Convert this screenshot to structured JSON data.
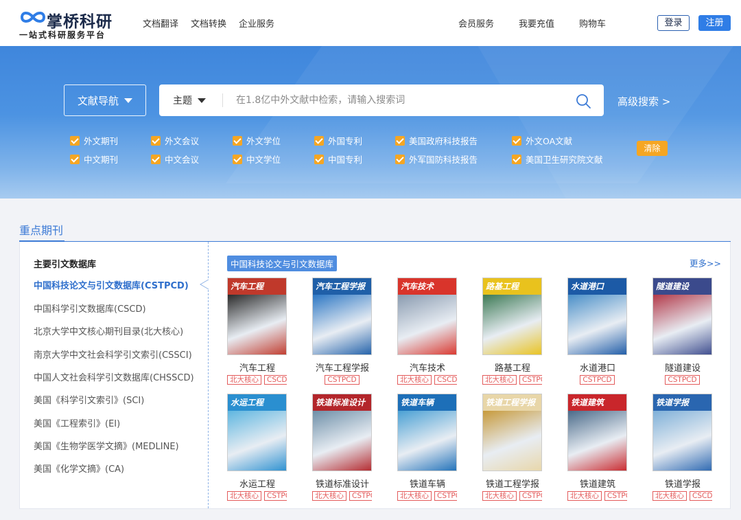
{
  "header": {
    "logo_name": "掌桥科研",
    "logo_slogan": "一站式科研服务平台",
    "nav_left": [
      "文档翻译",
      "文档转换",
      "企业服务"
    ],
    "nav_right": [
      "会员服务",
      "我要充值",
      "购物车"
    ],
    "login": "登录",
    "register": "注册"
  },
  "search": {
    "nav_dropdown": "文献导航",
    "scope": "主题",
    "placeholder": "在1.8亿中外文献中检索，请输入搜索词",
    "advanced": "高级搜索 >",
    "filters_row1": [
      "外文期刊",
      "外文会议",
      "外文学位",
      "外国专利",
      "美国政府科技报告",
      "外文OA文献"
    ],
    "filters_row2": [
      "中文期刊",
      "中文会议",
      "中文学位",
      "中国专利",
      "外军国防科技报告",
      "美国卫生研究院文献"
    ],
    "clear": "清除"
  },
  "section": {
    "title": "重点期刊",
    "sidebar_title": "主要引文数据库",
    "sidebar_items": [
      "中国科技论文与引文数据库(CSTPCD)",
      "中国科学引文数据库(CSCD)",
      "北京大学中文核心期刊目录(北大核心)",
      "南京大学中文社会科学引文索引(CSSCI)",
      "中国人文社会科学引文数据库(CHSSCD)",
      "美国《科学引文索引》(SCI)",
      "美国《工程索引》(EI)",
      "美国《生物学医学文摘》(MEDLINE)",
      "美国《化学文摘》(CA)"
    ],
    "active_db": "中国科技论文与引文数据库",
    "more": "更多>>"
  },
  "journals": [
    {
      "name": "汽车工程",
      "cover_title": "汽车工程",
      "badges": [
        "北大核心",
        "CSCD"
      ],
      "c1": "#c0392b",
      "c2": "#2b2b2b"
    },
    {
      "name": "汽车工程学报",
      "cover_title": "汽车工程学报",
      "badges": [
        "CSTPCD"
      ],
      "c1": "#1f5fa8",
      "c2": "#2d77c4"
    },
    {
      "name": "汽车技术",
      "cover_title": "汽车技术",
      "badges": [
        "北大核心",
        "CSCD"
      ],
      "c1": "#d9342b",
      "c2": "#8a9bb0"
    },
    {
      "name": "路基工程",
      "cover_title": "路基工程",
      "badges": [
        "北大核心",
        "CSTPCD"
      ],
      "c1": "#e9c21d",
      "c2": "#3d7a55"
    },
    {
      "name": "水道港口",
      "cover_title": "水道港口",
      "badges": [
        "CSTPCD"
      ],
      "c1": "#1c5aa6",
      "c2": "#4a8fc8"
    },
    {
      "name": "隧道建设",
      "cover_title": "隧道建设",
      "badges": [
        "CSTPCD"
      ],
      "c1": "#3b4a8c",
      "c2": "#b33a4a"
    },
    {
      "name": "水运工程",
      "cover_title": "水运工程",
      "badges": [
        "北大核心",
        "CSTPCD"
      ],
      "c1": "#2a8fd0",
      "c2": "#5fb6e0"
    },
    {
      "name": "铁道标准设计",
      "cover_title": "铁道标准设计",
      "badges": [
        "北大核心",
        "CSTPCD"
      ],
      "c1": "#b3262b",
      "c2": "#6e8fa8"
    },
    {
      "name": "铁道车辆",
      "cover_title": "铁道车辆",
      "badges": [
        "北大核心",
        "CSTPCD"
      ],
      "c1": "#1d6fb8",
      "c2": "#4aa0d4"
    },
    {
      "name": "铁道工程学报",
      "cover_title": "铁道工程学报",
      "badges": [
        "北大核心",
        "CSTPCD"
      ],
      "c1": "#e8d6a8",
      "c2": "#c79a3c"
    },
    {
      "name": "铁道建筑",
      "cover_title": "铁道建筑",
      "badges": [
        "北大核心",
        "CSTPCD"
      ],
      "c1": "#c9262b",
      "c2": "#4b6b8a"
    },
    {
      "name": "铁道学报",
      "cover_title": "铁道学报",
      "badges": [
        "北大核心",
        "CSCD"
      ],
      "c1": "#2a66b0",
      "c2": "#7fb0d8"
    }
  ]
}
